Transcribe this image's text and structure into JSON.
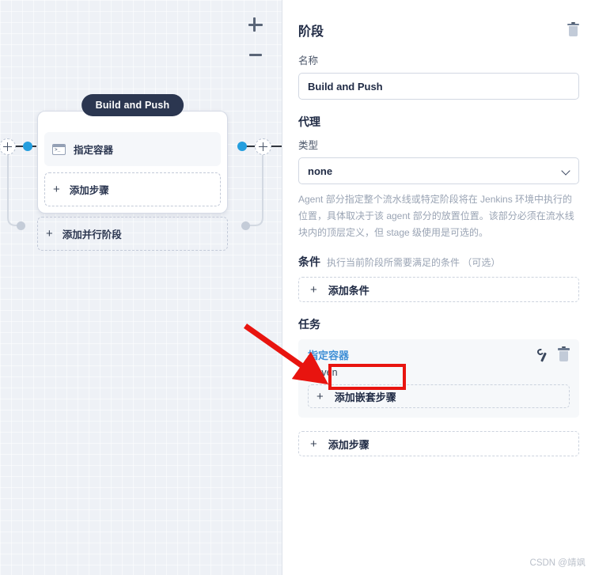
{
  "canvas": {
    "zoom_in_label": "+",
    "zoom_out_label": "−",
    "stage_title": "Build and Push",
    "step_label": "指定容器",
    "add_step_label": "添加步骤",
    "add_parallel_stage_label": "添加并行阶段",
    "node_color": "#249ede",
    "stage_pill_color": "#2b3650"
  },
  "panel": {
    "heading": "阶段",
    "delete_icon": "trash-icon",
    "name_label": "名称",
    "name_value": "Build and Push",
    "agent_heading": "代理",
    "type_label": "类型",
    "type_value": "none",
    "agent_help": "Agent 部分指定整个流水线或特定阶段将在 Jenkins 环境中执行的位置，具体取决于该 agent 部分的放置位置。该部分必须在流水线块内的顶层定义，但 stage 级使用是可选的。",
    "condition_heading": "条件",
    "condition_sub": "执行当前阶段所需要满足的条件 （可选）",
    "add_condition_label": "添加条件",
    "task_heading": "任务",
    "task_name": "指定容器",
    "task_name_color": "#3f8fd6",
    "task_edit_icon": "wrench-icon",
    "task_delete_icon": "trash-icon",
    "task_sub": "maven",
    "add_nested_step_label": "添加嵌套步骤",
    "add_step_label": "添加步骤"
  },
  "annotation": {
    "highlight_color": "#e8140f",
    "arrow_from": "310,412",
    "arrow_to": "400,478"
  },
  "watermark": "CSDN @靖飒"
}
